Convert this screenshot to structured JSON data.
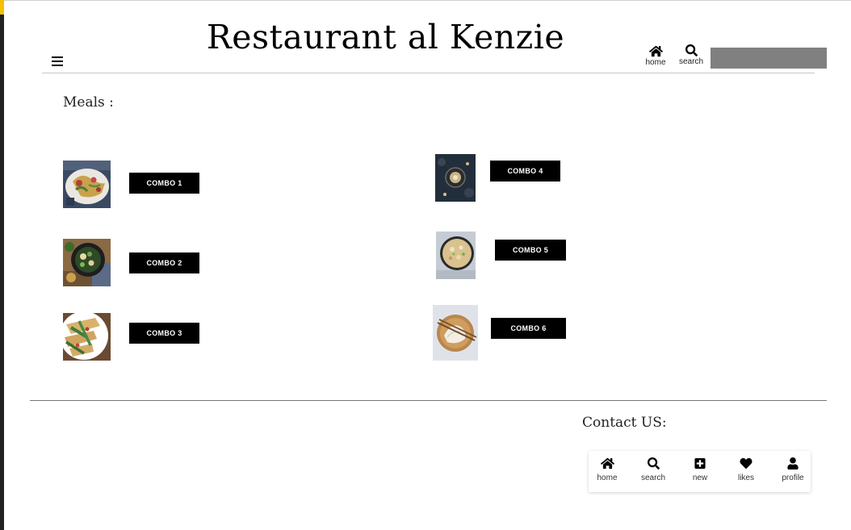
{
  "header": {
    "title": "Restaurant al Kenzie",
    "menu_icon": "hamburger-menu-icon",
    "nav": [
      {
        "label": "home",
        "icon": "home-icon"
      },
      {
        "label": "search",
        "icon": "search-icon"
      }
    ],
    "search_value": ""
  },
  "meals": {
    "heading": "Meals :",
    "items": [
      {
        "label": "COMBO 1",
        "image": "pasta-salad-plate"
      },
      {
        "label": "COMBO 2",
        "image": "veggie-skillet"
      },
      {
        "label": "COMBO 3",
        "image": "penne-greens-plate"
      },
      {
        "label": "COMBO 4",
        "image": "dark-table-dish"
      },
      {
        "label": "COMBO 5",
        "image": "fried-rice-bowl"
      },
      {
        "label": "COMBO 6",
        "image": "dumplings-wooden-plate"
      }
    ]
  },
  "contact": {
    "heading": "Contact US:"
  },
  "bottom_nav": {
    "items": [
      {
        "label": "home",
        "icon": "home-icon"
      },
      {
        "label": "search",
        "icon": "search-icon"
      },
      {
        "label": "new",
        "icon": "plus-square-icon"
      },
      {
        "label": "likes",
        "icon": "heart-icon"
      },
      {
        "label": "profile",
        "icon": "user-icon"
      }
    ]
  },
  "colors": {
    "button_bg": "#000000",
    "button_text": "#ffffff",
    "search_box": "#808080",
    "left_accent": "#f2c200",
    "left_bar": "#222222"
  }
}
